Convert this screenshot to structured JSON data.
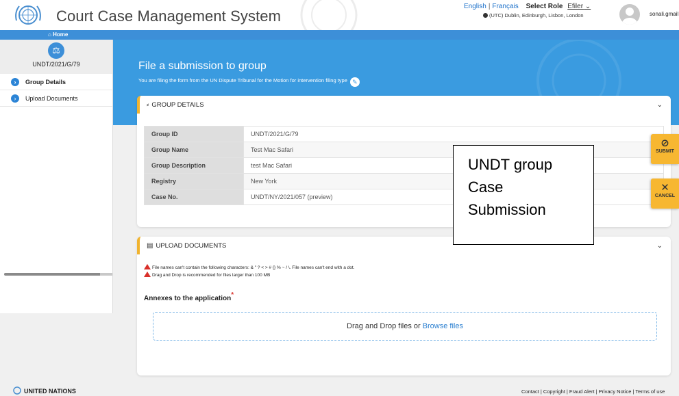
{
  "header": {
    "title": "Court Case Management System",
    "lang_en": "English",
    "lang_fr": "Français",
    "role_label": "Select Role",
    "role_value": "Efiler",
    "timezone": "(UTC) Dublin, Edinburgh, Lisbon, London",
    "user_email": "sonali.gmail"
  },
  "nav": {
    "home": "Home"
  },
  "sidebar": {
    "case_number": "UNDT/2021/G/79",
    "items": [
      {
        "label": "Group Details"
      },
      {
        "label": "Upload Documents"
      }
    ]
  },
  "banner": {
    "title": "File a submission to group",
    "subtitle": "You are filing the form from the UN Dispute Tribunal for the Motion for intervention filing type"
  },
  "group_details": {
    "heading": "GROUP DETAILS",
    "rows": [
      {
        "key": "Group ID",
        "value": "UNDT/2021/G/79"
      },
      {
        "key": "Group Name",
        "value": "Test Mac Safari"
      },
      {
        "key": "Group Description",
        "value": "test Mac Safari"
      },
      {
        "key": "Registry",
        "value": "New York"
      },
      {
        "key": "Case No.",
        "value": "UNDT/NY/2021/057 (preview)"
      }
    ]
  },
  "upload": {
    "heading": "UPLOAD DOCUMENTS",
    "warning1": "File names can't contain the following characters: & \" ? < > # {} % ~ / \\. File names can't end with a dot.",
    "warning2": "Drag and Drop is recommended for files larger than 100 MB",
    "annex_label": "Annexes to the application",
    "drop_text": "Drag and Drop files or",
    "browse": "Browse files"
  },
  "annotation": {
    "line1": "UNDT group",
    "line2": "Case",
    "line3": "Submission"
  },
  "actions": {
    "submit": "SUBMIT",
    "cancel": "CANCEL"
  },
  "footer": {
    "org": "UNITED NATIONS",
    "links": [
      "Contact",
      "Copyright",
      "Fraud Alert",
      "Privacy Notice",
      "Terms of use"
    ]
  },
  "colors": {
    "brand_blue": "#3a9be0",
    "accent_yellow": "#f7b731",
    "warning_red": "#d9302a"
  }
}
